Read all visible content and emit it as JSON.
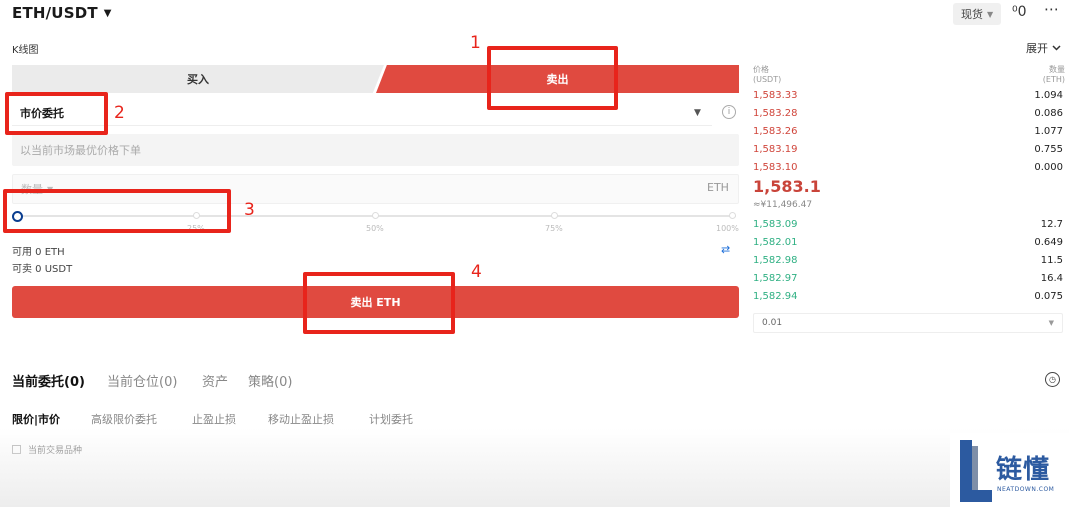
{
  "header": {
    "pair": "ETH/USDT",
    "spot_label": "现货",
    "kline_label": "K线图",
    "expand_label": "展开",
    "more_icon": "more-dots-icon",
    "mode_icon": "toggle-icon"
  },
  "trade": {
    "buy_tab": "买入",
    "sell_tab": "卖出",
    "order_type": "市价委托",
    "market_placeholder": "以当前市场最优价格下单",
    "qty_placeholder": "数量",
    "qty_unit": "ETH",
    "slider_level": 0,
    "slider_ticks": [
      "25%",
      "50%",
      "75%",
      "100%"
    ],
    "available": "可用 0 ETH",
    "sellable": "可卖 0 USDT",
    "submit": "卖出 ETH"
  },
  "orderbook": {
    "price_header": "价格 (USDT)",
    "qty_header": "数量 (ETH)",
    "asks": [
      {
        "price": "1,583.33",
        "qty": "1.094"
      },
      {
        "price": "1,583.28",
        "qty": "0.086"
      },
      {
        "price": "1,583.26",
        "qty": "1.077"
      },
      {
        "price": "1,583.19",
        "qty": "0.755"
      },
      {
        "price": "1,583.10",
        "qty": "0.000"
      }
    ],
    "last_price": "1,583.1",
    "last_cny": "≈¥11,496.47",
    "bids": [
      {
        "price": "1,583.09",
        "qty": "12.7"
      },
      {
        "price": "1,582.01",
        "qty": "0.649"
      },
      {
        "price": "1,582.98",
        "qty": "11.5"
      },
      {
        "price": "1,582.97",
        "qty": "16.4"
      },
      {
        "price": "1,582.94",
        "qty": "0.075"
      }
    ],
    "depth": "0.01"
  },
  "bottom": {
    "tabs": [
      "当前委托(0)",
      "当前仓位(0)",
      "资产",
      "策略(0)"
    ],
    "subtabs": [
      "限价|市价",
      "高级限价委托",
      "止盈止损",
      "移动止盈止损",
      "计划委托"
    ],
    "checkbox_label": "当前交易品种"
  },
  "annotations": [
    "1",
    "2",
    "3",
    "4"
  ],
  "watermark": {
    "name": "链懂",
    "url": "NEATDOWN.COM"
  },
  "colors": {
    "sell": "#e04a40",
    "ask": "#d0453b",
    "bid": "#2fb083",
    "annotation": "#e8241b"
  }
}
